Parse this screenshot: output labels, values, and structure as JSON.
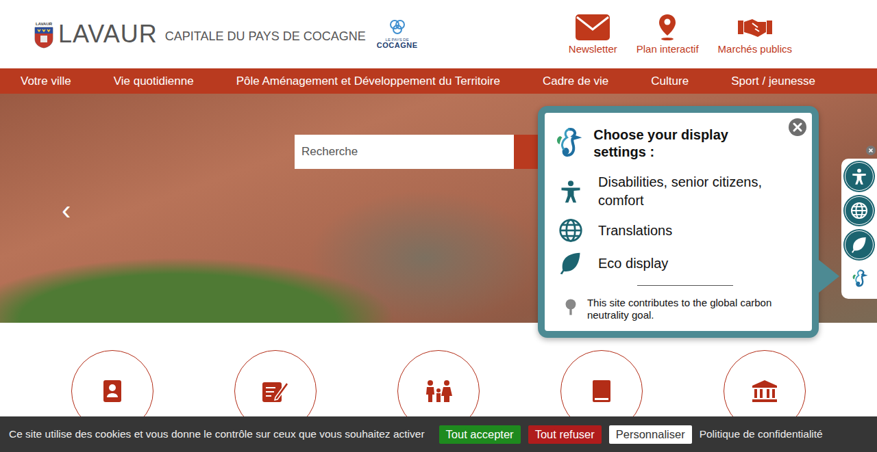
{
  "header": {
    "logo": {
      "shield_label": "LAVAUR",
      "title": "LAVAUR",
      "subtitle": "CAPITALE DU PAYS DE COCAGNE"
    },
    "partner_logo": {
      "line1": "LE PAYS DE",
      "line2": "COCAGNE"
    },
    "links": [
      {
        "label": "Newsletter",
        "kind": "mail"
      },
      {
        "label": "Plan interactif",
        "kind": "pin"
      },
      {
        "label": "Marchés publics",
        "kind": "handshake"
      }
    ]
  },
  "nav": [
    "Votre ville",
    "Vie quotidienne",
    "Pôle Aménagement et Développement du Territoire",
    "Cadre de vie",
    "Culture",
    "Sport / jeunesse"
  ],
  "hero": {
    "search": {
      "placeholder": "Recherche"
    },
    "prev": "‹"
  },
  "quick_links": [
    {
      "kind": "contacts"
    },
    {
      "kind": "form"
    },
    {
      "kind": "family"
    },
    {
      "kind": "book"
    },
    {
      "kind": "building"
    }
  ],
  "display_panel": {
    "title": "Choose your display settings :",
    "options": [
      {
        "label": "Disabilities, senior citizens, comfort",
        "kind": "accessibility"
      },
      {
        "label": "Translations",
        "kind": "globe"
      },
      {
        "label": "Eco display",
        "kind": "leaf"
      }
    ],
    "note": "This site contributes to the global carbon neutrality goal."
  },
  "side_toolbar": [
    {
      "kind": "accessibility"
    },
    {
      "kind": "globe"
    },
    {
      "kind": "leaf"
    },
    {
      "kind": "seahorse"
    }
  ],
  "cookie_bar": {
    "message": "Ce site utilise des cookies et vous donne le contrôle sur ceux que vous souhaitez activer",
    "buttons": [
      {
        "label": "Tout accepter",
        "color": "#1e8a1e"
      },
      {
        "label": "Tout refuser",
        "color": "#b01c1c"
      },
      {
        "label": "Personnaliser",
        "color": "#ffffff"
      }
    ],
    "link": "Politique de confidentialité"
  }
}
